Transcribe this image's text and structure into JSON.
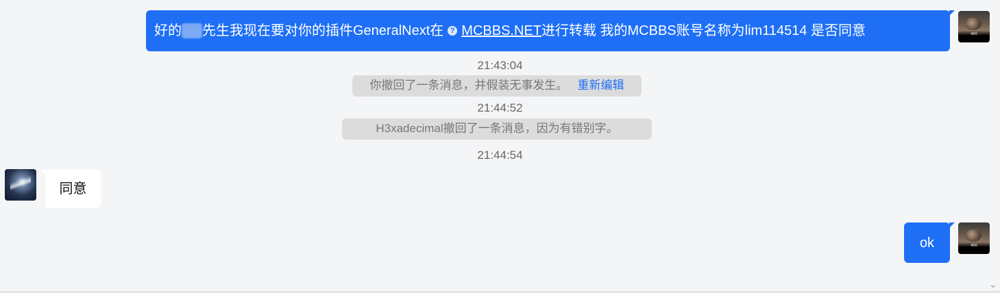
{
  "messages": [
    {
      "sender": "self",
      "parts": {
        "pre": "好的",
        "post": "先生我现在要对你的插件GeneralNext在",
        "link": "MCBBS.NET",
        "tail": "进行转载 我的MCBBS账号名称为lim114514 是否同意"
      }
    },
    {
      "type": "time",
      "text": "21:43:04"
    },
    {
      "type": "notice",
      "text": "你撤回了一条消息，并假装无事发生。",
      "action": "重新编辑"
    },
    {
      "type": "time",
      "text": "21:44:52"
    },
    {
      "type": "notice",
      "text": "H3xadecimal撤回了一条消息，因为有错别字。"
    },
    {
      "type": "time",
      "text": "21:44:54"
    },
    {
      "sender": "other",
      "text": "同意"
    },
    {
      "sender": "self",
      "text": "ok"
    }
  ],
  "avatar_self_caption": "400",
  "colors": {
    "self_bubble": "#1e6ff5",
    "other_bubble": "#ffffff",
    "background": "#f4f5f7",
    "notice_bg": "#dcdcdc",
    "link": "#1e6ff5"
  }
}
